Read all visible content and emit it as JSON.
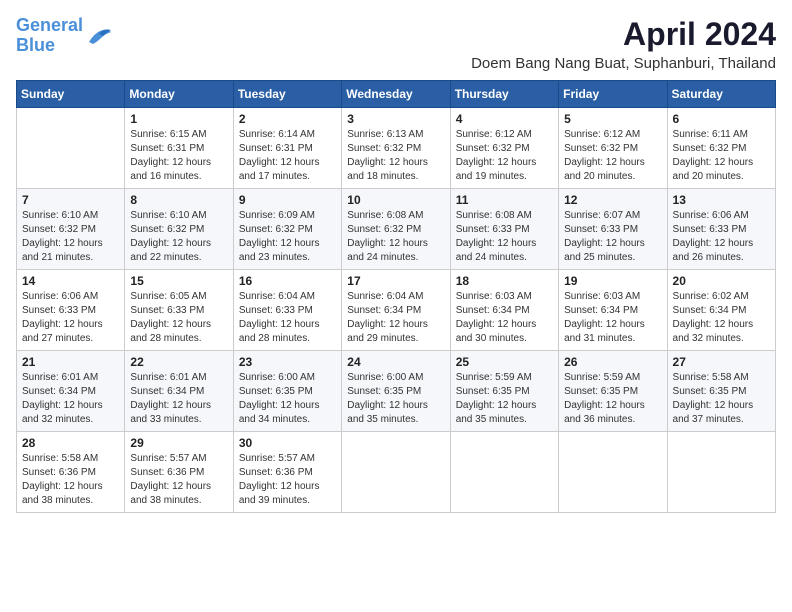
{
  "header": {
    "logo_line1": "General",
    "logo_line2": "Blue",
    "title": "April 2024",
    "subtitle": "Doem Bang Nang Buat, Suphanburi, Thailand"
  },
  "weekdays": [
    "Sunday",
    "Monday",
    "Tuesday",
    "Wednesday",
    "Thursday",
    "Friday",
    "Saturday"
  ],
  "weeks": [
    [
      {
        "day": "",
        "info": ""
      },
      {
        "day": "1",
        "info": "Sunrise: 6:15 AM\nSunset: 6:31 PM\nDaylight: 12 hours\nand 16 minutes."
      },
      {
        "day": "2",
        "info": "Sunrise: 6:14 AM\nSunset: 6:31 PM\nDaylight: 12 hours\nand 17 minutes."
      },
      {
        "day": "3",
        "info": "Sunrise: 6:13 AM\nSunset: 6:32 PM\nDaylight: 12 hours\nand 18 minutes."
      },
      {
        "day": "4",
        "info": "Sunrise: 6:12 AM\nSunset: 6:32 PM\nDaylight: 12 hours\nand 19 minutes."
      },
      {
        "day": "5",
        "info": "Sunrise: 6:12 AM\nSunset: 6:32 PM\nDaylight: 12 hours\nand 20 minutes."
      },
      {
        "day": "6",
        "info": "Sunrise: 6:11 AM\nSunset: 6:32 PM\nDaylight: 12 hours\nand 20 minutes."
      }
    ],
    [
      {
        "day": "7",
        "info": "Sunrise: 6:10 AM\nSunset: 6:32 PM\nDaylight: 12 hours\nand 21 minutes."
      },
      {
        "day": "8",
        "info": "Sunrise: 6:10 AM\nSunset: 6:32 PM\nDaylight: 12 hours\nand 22 minutes."
      },
      {
        "day": "9",
        "info": "Sunrise: 6:09 AM\nSunset: 6:32 PM\nDaylight: 12 hours\nand 23 minutes."
      },
      {
        "day": "10",
        "info": "Sunrise: 6:08 AM\nSunset: 6:32 PM\nDaylight: 12 hours\nand 24 minutes."
      },
      {
        "day": "11",
        "info": "Sunrise: 6:08 AM\nSunset: 6:33 PM\nDaylight: 12 hours\nand 24 minutes."
      },
      {
        "day": "12",
        "info": "Sunrise: 6:07 AM\nSunset: 6:33 PM\nDaylight: 12 hours\nand 25 minutes."
      },
      {
        "day": "13",
        "info": "Sunrise: 6:06 AM\nSunset: 6:33 PM\nDaylight: 12 hours\nand 26 minutes."
      }
    ],
    [
      {
        "day": "14",
        "info": "Sunrise: 6:06 AM\nSunset: 6:33 PM\nDaylight: 12 hours\nand 27 minutes."
      },
      {
        "day": "15",
        "info": "Sunrise: 6:05 AM\nSunset: 6:33 PM\nDaylight: 12 hours\nand 28 minutes."
      },
      {
        "day": "16",
        "info": "Sunrise: 6:04 AM\nSunset: 6:33 PM\nDaylight: 12 hours\nand 28 minutes."
      },
      {
        "day": "17",
        "info": "Sunrise: 6:04 AM\nSunset: 6:34 PM\nDaylight: 12 hours\nand 29 minutes."
      },
      {
        "day": "18",
        "info": "Sunrise: 6:03 AM\nSunset: 6:34 PM\nDaylight: 12 hours\nand 30 minutes."
      },
      {
        "day": "19",
        "info": "Sunrise: 6:03 AM\nSunset: 6:34 PM\nDaylight: 12 hours\nand 31 minutes."
      },
      {
        "day": "20",
        "info": "Sunrise: 6:02 AM\nSunset: 6:34 PM\nDaylight: 12 hours\nand 32 minutes."
      }
    ],
    [
      {
        "day": "21",
        "info": "Sunrise: 6:01 AM\nSunset: 6:34 PM\nDaylight: 12 hours\nand 32 minutes."
      },
      {
        "day": "22",
        "info": "Sunrise: 6:01 AM\nSunset: 6:34 PM\nDaylight: 12 hours\nand 33 minutes."
      },
      {
        "day": "23",
        "info": "Sunrise: 6:00 AM\nSunset: 6:35 PM\nDaylight: 12 hours\nand 34 minutes."
      },
      {
        "day": "24",
        "info": "Sunrise: 6:00 AM\nSunset: 6:35 PM\nDaylight: 12 hours\nand 35 minutes."
      },
      {
        "day": "25",
        "info": "Sunrise: 5:59 AM\nSunset: 6:35 PM\nDaylight: 12 hours\nand 35 minutes."
      },
      {
        "day": "26",
        "info": "Sunrise: 5:59 AM\nSunset: 6:35 PM\nDaylight: 12 hours\nand 36 minutes."
      },
      {
        "day": "27",
        "info": "Sunrise: 5:58 AM\nSunset: 6:35 PM\nDaylight: 12 hours\nand 37 minutes."
      }
    ],
    [
      {
        "day": "28",
        "info": "Sunrise: 5:58 AM\nSunset: 6:36 PM\nDaylight: 12 hours\nand 38 minutes."
      },
      {
        "day": "29",
        "info": "Sunrise: 5:57 AM\nSunset: 6:36 PM\nDaylight: 12 hours\nand 38 minutes."
      },
      {
        "day": "30",
        "info": "Sunrise: 5:57 AM\nSunset: 6:36 PM\nDaylight: 12 hours\nand 39 minutes."
      },
      {
        "day": "",
        "info": ""
      },
      {
        "day": "",
        "info": ""
      },
      {
        "day": "",
        "info": ""
      },
      {
        "day": "",
        "info": ""
      }
    ]
  ]
}
